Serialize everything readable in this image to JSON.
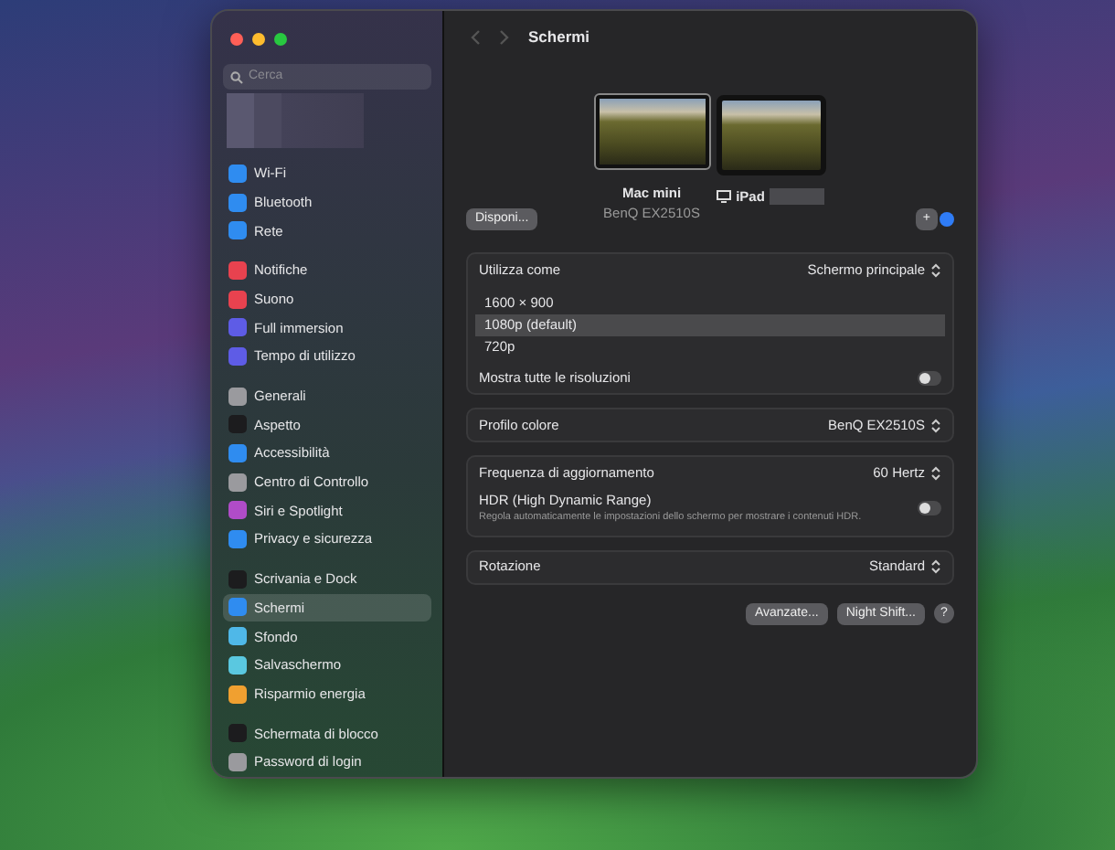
{
  "window": {
    "title": "Schermi"
  },
  "sidebar": {
    "search": {
      "placeholder": "Cerca"
    },
    "groups": [
      [
        {
          "label": "Wi-Fi",
          "color": "#2f8cf0",
          "selected": false
        },
        {
          "label": "Bluetooth",
          "color": "#2f8cf0",
          "selected": false
        },
        {
          "label": "Rete",
          "color": "#2f8cf0",
          "selected": false
        }
      ],
      [
        {
          "label": "Notifiche",
          "color": "#e8424f",
          "selected": false
        },
        {
          "label": "Suono",
          "color": "#e8424f",
          "selected": false
        },
        {
          "label": "Full immersion",
          "color": "#5e5ce6",
          "selected": false
        },
        {
          "label": "Tempo di utilizzo",
          "color": "#5e5ce6",
          "selected": false
        }
      ],
      [
        {
          "label": "Generali",
          "color": "#9a9a9e",
          "selected": false
        },
        {
          "label": "Aspetto",
          "color": "#1c1c1e",
          "selected": false
        },
        {
          "label": "Accessibilità",
          "color": "#2f8cf0",
          "selected": false
        },
        {
          "label": "Centro di Controllo",
          "color": "#9a9a9e",
          "selected": false
        },
        {
          "label": "Siri e Spotlight",
          "color": "#b04cc8",
          "selected": false
        },
        {
          "label": "Privacy e sicurezza",
          "color": "#2f8cf0",
          "selected": false
        }
      ],
      [
        {
          "label": "Scrivania e Dock",
          "color": "#1c1c1e",
          "selected": false
        },
        {
          "label": "Schermi",
          "color": "#2f8cf0",
          "selected": true
        },
        {
          "label": "Sfondo",
          "color": "#4fb8e8",
          "selected": false
        },
        {
          "label": "Salvaschermo",
          "color": "#5ac8e0",
          "selected": false
        },
        {
          "label": "Risparmio energia",
          "color": "#f0a030",
          "selected": false
        }
      ],
      [
        {
          "label": "Schermata di blocco",
          "color": "#1c1c1e",
          "selected": false
        },
        {
          "label": "Password di login",
          "color": "#9a9a9e",
          "selected": false
        }
      ]
    ]
  },
  "displays": [
    {
      "name": "Mac mini",
      "model": "BenQ EX2510S",
      "selected": true
    },
    {
      "name": "iPad",
      "selected": false
    }
  ],
  "arrange_button": "Disponi...",
  "add_button": "+",
  "use_as": {
    "label": "Utilizza come",
    "value": "Schermo principale"
  },
  "resolutions": [
    {
      "label": "1600 × 900",
      "selected": false
    },
    {
      "label": "1080p (default)",
      "selected": true
    },
    {
      "label": "720p",
      "selected": false
    }
  ],
  "show_all_resolutions": {
    "label": "Mostra tutte le risoluzioni",
    "on": false
  },
  "color_profile": {
    "label": "Profilo colore",
    "value": "BenQ EX2510S"
  },
  "refresh_rate": {
    "label": "Frequenza di aggiornamento",
    "value": "60 Hertz"
  },
  "hdr": {
    "label": "HDR (High Dynamic Range)",
    "description": "Regola automaticamente le impostazioni dello schermo per mostrare i contenuti HDR.",
    "on": false
  },
  "rotation": {
    "label": "Rotazione",
    "value": "Standard"
  },
  "buttons": [
    "Avanzate...",
    "Night Shift...",
    "?"
  ]
}
